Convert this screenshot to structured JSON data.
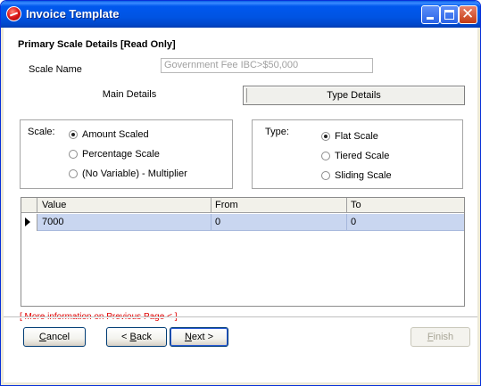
{
  "window": {
    "title": "Invoice Template",
    "controls": {
      "minimize": "minimize",
      "maximize": "maximize",
      "close": "✕"
    }
  },
  "header": {
    "section_title": "Primary Scale Details [Read Only]",
    "scale_name_label": "Scale Name",
    "scale_name_value": "Government Fee IBC>$50,000"
  },
  "tabs": [
    {
      "label": "Main Details",
      "active": false
    },
    {
      "label": "Type Details",
      "active": true
    }
  ],
  "scale_group": {
    "label": "Scale:",
    "options": [
      {
        "label": "Amount Scaled",
        "selected": true
      },
      {
        "label": "Percentage Scale",
        "selected": false
      },
      {
        "label": "(No Variable) - Multiplier",
        "selected": false
      }
    ]
  },
  "type_group": {
    "label": "Type:",
    "options": [
      {
        "label": "Flat Scale",
        "selected": true
      },
      {
        "label": "Tiered Scale",
        "selected": false
      },
      {
        "label": "Sliding Scale",
        "selected": false
      }
    ]
  },
  "grid": {
    "columns": [
      "Value",
      "From",
      "To"
    ],
    "rows": [
      {
        "value": "7000",
        "from": "0",
        "to": "0"
      }
    ]
  },
  "more_info": "[ More information on Previous Page < ]",
  "buttons": {
    "cancel_mnemonic": "C",
    "cancel_rest": "ancel",
    "back_prefix": "< ",
    "back_mnemonic": "B",
    "back_rest": "ack",
    "next_mnemonic": "N",
    "next_rest": "ext >",
    "finish_mnemonic": "F",
    "finish_rest": "inish"
  },
  "colors": {
    "titlebar": "#0054e3",
    "link_red": "#e00000",
    "grid_selection": "#c9d6f0"
  }
}
